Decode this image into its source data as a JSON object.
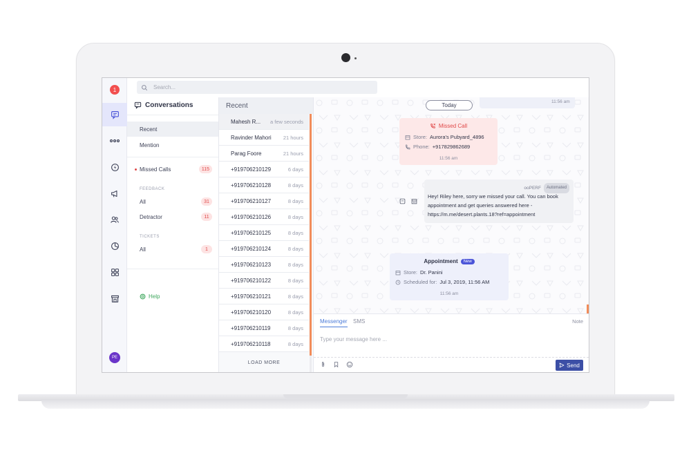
{
  "rail": {
    "notification_count": "1",
    "avatar_initials": "PE"
  },
  "search": {
    "placeholder": "Search..."
  },
  "conversations": {
    "title": "Conversations",
    "recent_label": "Recent",
    "mention_label": "Mention",
    "missed_calls_label": "Missed Calls",
    "missed_calls_count": "115",
    "feedback_section": "FEEDBACK",
    "feedback_all_label": "All",
    "feedback_all_count": "31",
    "detractor_label": "Detractor",
    "detractor_count": "11",
    "tickets_section": "TICKETS",
    "tickets_all_label": "All",
    "tickets_all_count": "1",
    "help_label": "Help"
  },
  "recent": {
    "header": "Recent",
    "rows": [
      {
        "name": "Mahesh R...",
        "time": "a few seconds"
      },
      {
        "name": "Ravinder Mahori",
        "time": "21 hours"
      },
      {
        "name": "Parag Foore",
        "time": "21 hours"
      },
      {
        "name": "+919706210129",
        "time": "6 days"
      },
      {
        "name": "+919706210128",
        "time": "8 days"
      },
      {
        "name": "+919706210127",
        "time": "8 days"
      },
      {
        "name": "+919706210126",
        "time": "8 days"
      },
      {
        "name": "+919706210125",
        "time": "8 days"
      },
      {
        "name": "+919706210124",
        "time": "8 days"
      },
      {
        "name": "+919706210123",
        "time": "8 days"
      },
      {
        "name": "+919706210122",
        "time": "8 days"
      },
      {
        "name": "+919706210121",
        "time": "8 days"
      },
      {
        "name": "+919706210120",
        "time": "8 days"
      },
      {
        "name": "+919706210119",
        "time": "8 days"
      },
      {
        "name": "+919706210118",
        "time": "8 days"
      }
    ],
    "load_more": "LOAD MORE"
  },
  "chat": {
    "top_time": "11:56 am",
    "today_label": "Today",
    "missed_call": {
      "title": "Missed Call",
      "store_key": "Store:",
      "store_value": "Aurora's Pubyard_4896",
      "phone_key": "Phone:",
      "phone_value": "+917829862689",
      "time": "11:56 am"
    },
    "message": {
      "sender": "ooPERF",
      "tag": "Automated",
      "text": "Hey! Riley here, sorry we missed your call. You can book appointment and get queries answered here - https://m.me/desert.plants.18?ref=appointment"
    },
    "appointment": {
      "title": "Appointment",
      "tag": "New",
      "store_key": "Store:",
      "store_value": "Dr. Panini",
      "scheduled_key": "Scheduled for:",
      "scheduled_value": "Jul 3, 2019, 11:56 AM",
      "time": "11:56 am"
    }
  },
  "composer": {
    "tab_messenger": "Messenger",
    "tab_sms": "SMS",
    "note_label": "Note",
    "placeholder": "Type your message here ...",
    "send_label": "Send"
  }
}
